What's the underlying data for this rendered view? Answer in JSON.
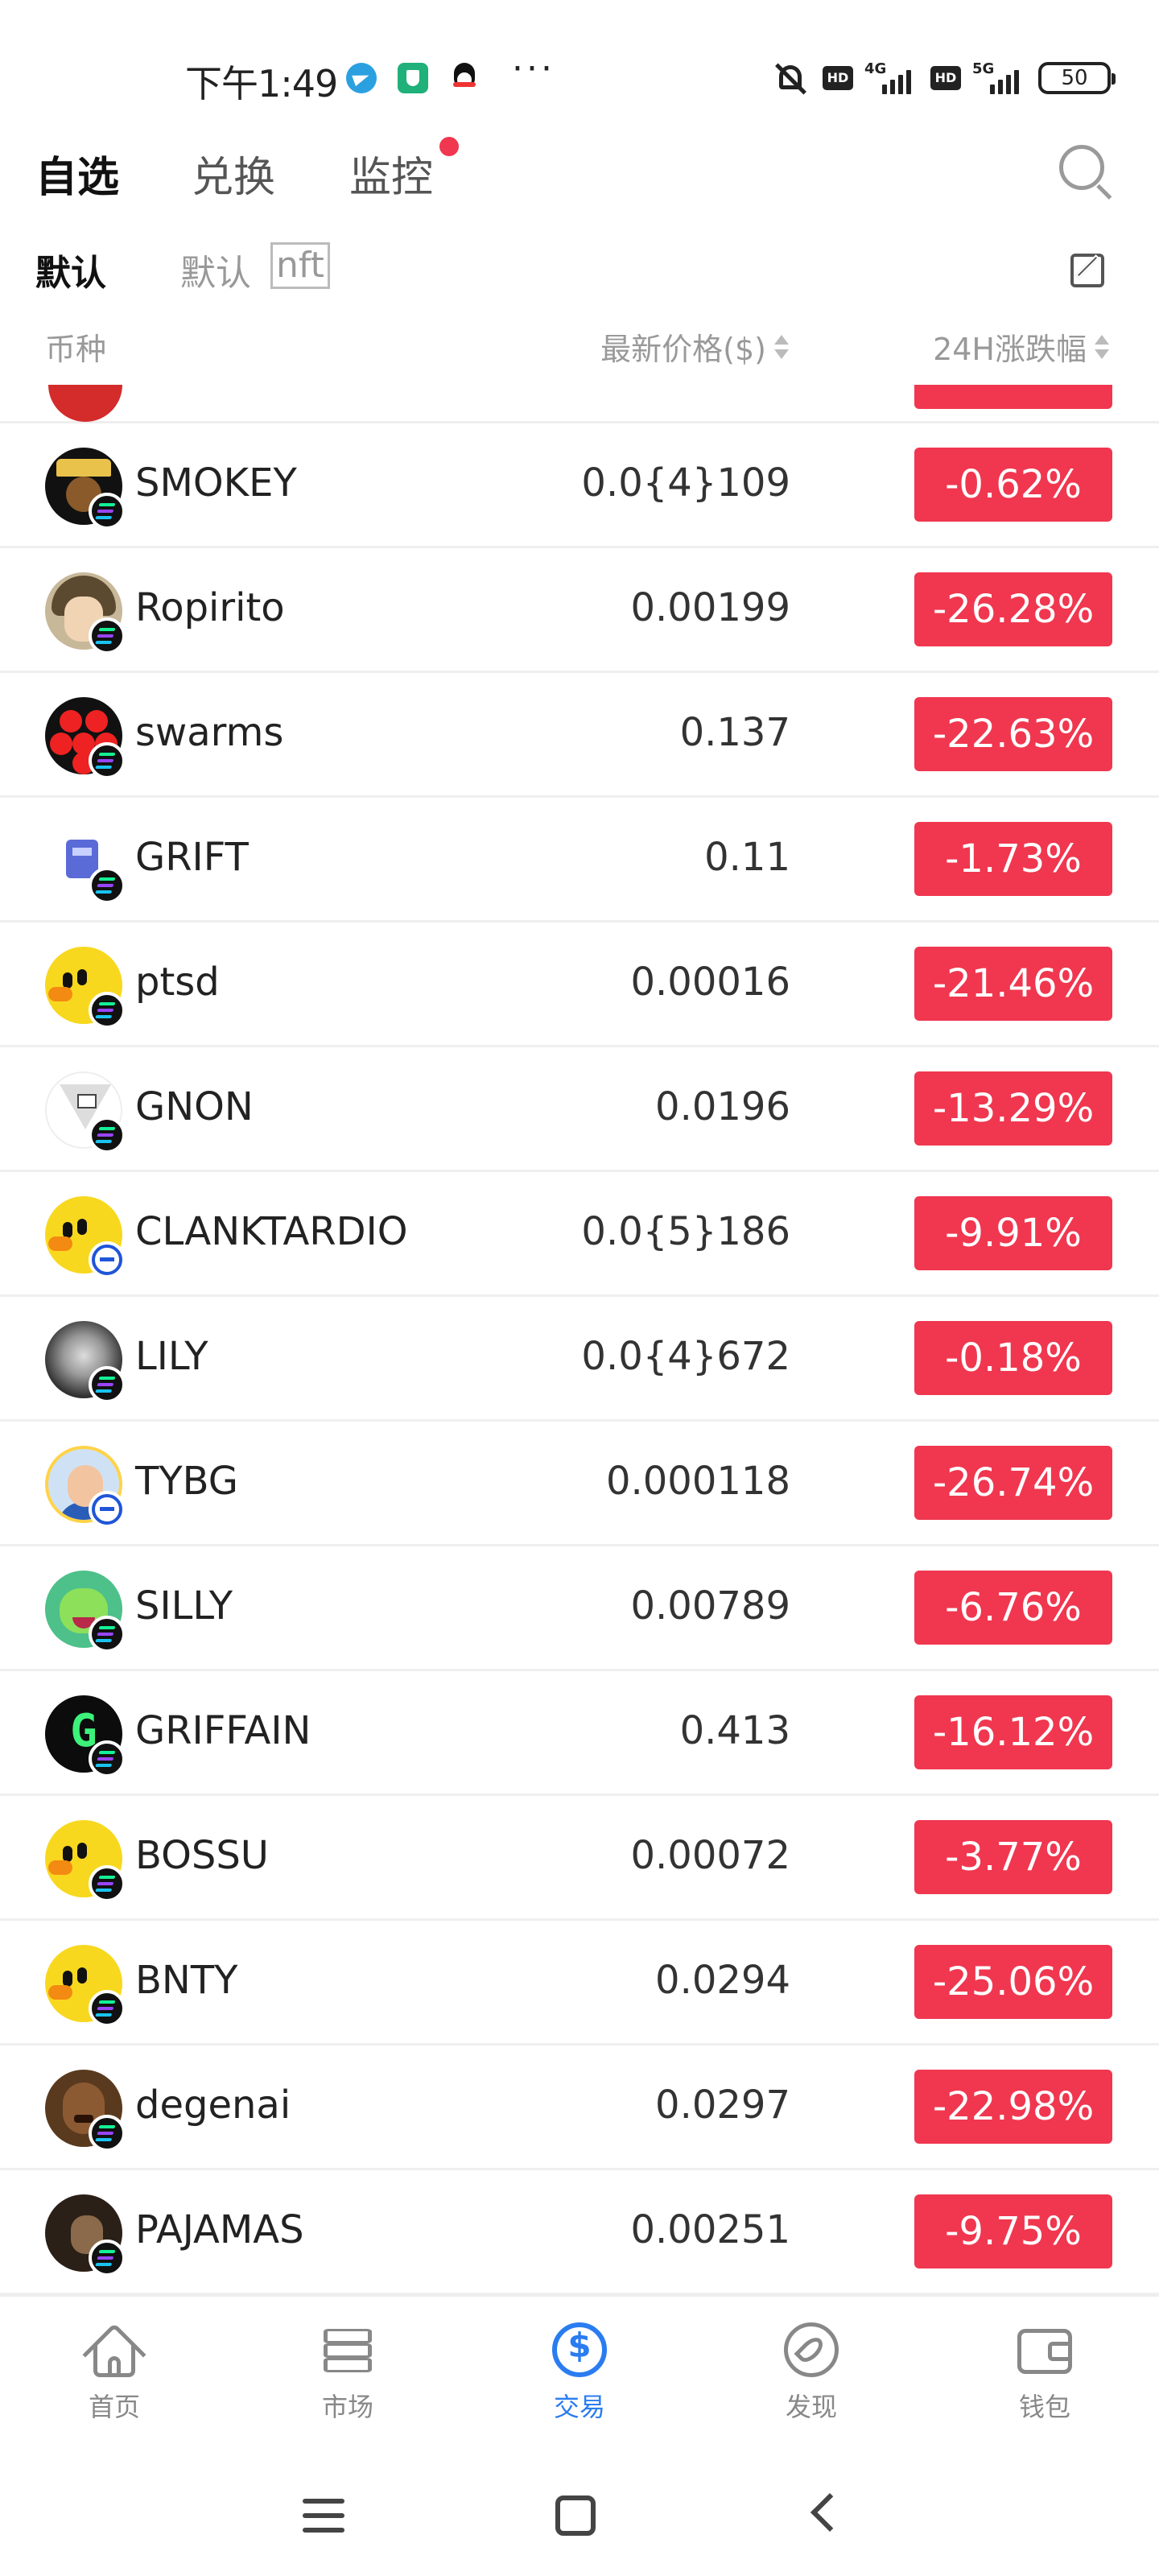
{
  "status_bar": {
    "time": "下午1:49",
    "dots": "···",
    "hd": "HD",
    "net1": "4G",
    "net2": "5G",
    "battery": "50"
  },
  "top_tabs": [
    {
      "label": "自选",
      "active": true
    },
    {
      "label": "兑换",
      "active": false
    },
    {
      "label": "监控",
      "active": false,
      "dot": true
    }
  ],
  "sub_tabs": [
    {
      "label": "默认",
      "active": true
    },
    {
      "label": "默认",
      "active": false
    }
  ],
  "nft_tag": "nft",
  "columns": {
    "coin": "币种",
    "price": "最新价格($)",
    "change": "24H涨跌幅"
  },
  "rows": [
    {
      "symbol": "SMOKEY",
      "price": "0.0{4}109",
      "change": "-0.62%",
      "avatar": "smokey-avatar",
      "chain": "solana"
    },
    {
      "symbol": "Ropirito",
      "price": "0.00199",
      "change": "-26.28%",
      "avatar": "ropirito-avatar",
      "chain": "solana"
    },
    {
      "symbol": "swarms",
      "price": "0.137",
      "change": "-22.63%",
      "avatar": "swarms-avatar",
      "chain": "solana"
    },
    {
      "symbol": "GRIFT",
      "price": "0.11",
      "change": "-1.73%",
      "avatar": "grift-avatar",
      "chain": "solana"
    },
    {
      "symbol": "ptsd",
      "price": "0.00016",
      "change": "-21.46%",
      "avatar": "default-duck-avatar",
      "chain": "solana"
    },
    {
      "symbol": "GNON",
      "price": "0.0196",
      "change": "-13.29%",
      "avatar": "gnon-avatar",
      "chain": "solana"
    },
    {
      "symbol": "CLANKTARDIO",
      "price": "0.0{5}186",
      "change": "-9.91%",
      "avatar": "default-duck-avatar",
      "chain": "base"
    },
    {
      "symbol": "LILY",
      "price": "0.0{4}672",
      "change": "-0.18%",
      "avatar": "lily-avatar",
      "chain": "solana"
    },
    {
      "symbol": "TYBG",
      "price": "0.000118",
      "change": "-26.74%",
      "avatar": "tybg-avatar",
      "chain": "base"
    },
    {
      "symbol": "SILLY",
      "price": "0.00789",
      "change": "-6.76%",
      "avatar": "silly-avatar",
      "chain": "solana"
    },
    {
      "symbol": "GRIFFAIN",
      "price": "0.413",
      "change": "-16.12%",
      "avatar": "griffain-avatar",
      "chain": "solana"
    },
    {
      "symbol": "BOSSU",
      "price": "0.00072",
      "change": "-3.77%",
      "avatar": "default-duck-avatar",
      "chain": "solana"
    },
    {
      "symbol": "BNTY",
      "price": "0.0294",
      "change": "-25.06%",
      "avatar": "default-duck-avatar",
      "chain": "solana"
    },
    {
      "symbol": "degenai",
      "price": "0.0297",
      "change": "-22.98%",
      "avatar": "degenai-avatar",
      "chain": "solana"
    },
    {
      "symbol": "PAJAMAS",
      "price": "0.00251",
      "change": "-9.75%",
      "avatar": "pajamas-avatar",
      "chain": "solana"
    }
  ],
  "bottom_nav": [
    {
      "label": "首页",
      "icon": "home-icon",
      "active": false
    },
    {
      "label": "市场",
      "icon": "layers-icon",
      "active": false
    },
    {
      "label": "交易",
      "icon": "trade-icon",
      "active": true
    },
    {
      "label": "发现",
      "icon": "compass-icon",
      "active": false
    },
    {
      "label": "钱包",
      "icon": "wallet-icon",
      "active": false
    }
  ],
  "colors": {
    "down": "#f0374f",
    "accent": "#2a7cf0",
    "notify_dot": "#f0374f"
  }
}
